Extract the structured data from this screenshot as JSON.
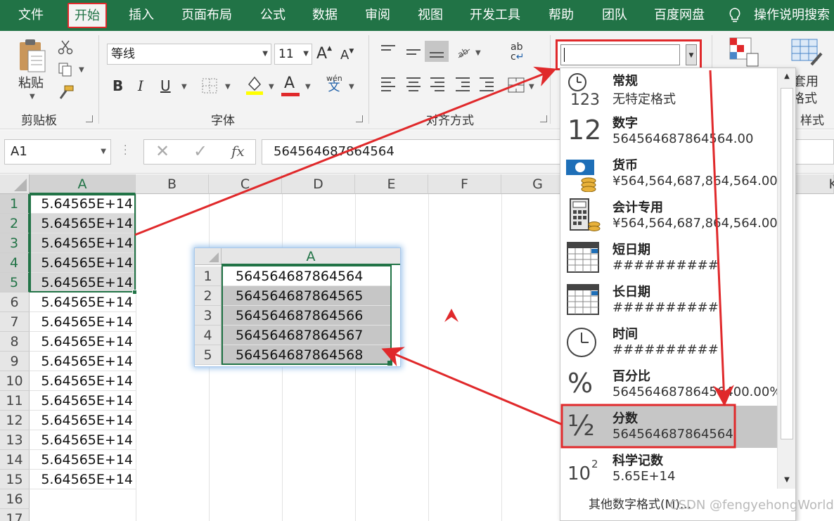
{
  "tabs": [
    "文件",
    "开始",
    "插入",
    "页面布局",
    "公式",
    "数据",
    "审阅",
    "视图",
    "开发工具",
    "帮助",
    "团队",
    "百度网盘"
  ],
  "tab_search": "操作说明搜索",
  "colors": {
    "accent": "#217346",
    "highlight": "#e0292b"
  },
  "ribbon": {
    "clipboard": {
      "paste_label": "粘贴",
      "group_label": "剪贴板"
    },
    "font": {
      "font_name": "等线",
      "font_size": "11",
      "bold": "B",
      "italic": "I",
      "underline": "U",
      "font_color_letter": "A",
      "wen": "wén",
      "wen2": "文",
      "grow": "A",
      "shrink": "A",
      "group_label": "字体"
    },
    "align": {
      "group_label": "对齐方式",
      "ab": "ab",
      "c": "c"
    },
    "styles": {
      "table_format_1": "套用",
      "table_format_2": "格式",
      "group_label": "样式"
    }
  },
  "formula_bar": {
    "name_box": "A1",
    "fx": "fx",
    "value": "564564687864564"
  },
  "grid": {
    "columns": [
      "A",
      "B",
      "C",
      "D",
      "E",
      "F",
      "G",
      "K"
    ],
    "rows": [
      "1",
      "2",
      "3",
      "4",
      "5",
      "6",
      "7",
      "8",
      "9",
      "10",
      "11",
      "12",
      "13",
      "14",
      "15",
      "16",
      "17"
    ],
    "col_a_values": [
      "5.64565E+14",
      "5.64565E+14",
      "5.64565E+14",
      "5.64565E+14",
      "5.64565E+14",
      "5.64565E+14",
      "5.64565E+14",
      "5.64565E+14",
      "5.64565E+14",
      "5.64565E+14",
      "5.64565E+14",
      "5.64565E+14",
      "5.64565E+14",
      "5.64565E+14",
      "5.64565E+14"
    ]
  },
  "inset": {
    "column": "A",
    "rows": [
      "1",
      "2",
      "3",
      "4",
      "5"
    ],
    "values": [
      "564564687864564",
      "564564687864565",
      "564564687864566",
      "564564687864567",
      "564564687864568"
    ]
  },
  "number_format": {
    "current": "",
    "items": [
      {
        "name": "常规",
        "preview": "无特定格式",
        "icon": "clock-123-icon"
      },
      {
        "name": "数字",
        "preview": "564564687864564.00",
        "icon": "number-12-icon",
        "icon_text": "12"
      },
      {
        "name": "货币",
        "preview": "¥564,564,687,864,564.00",
        "icon": "banknote-coins-icon"
      },
      {
        "name": "会计专用",
        "preview": " ¥564,564,687,864,564.00",
        "icon": "calculator-coins-icon"
      },
      {
        "name": "短日期",
        "preview": "##########",
        "icon": "calendar-icon"
      },
      {
        "name": "长日期",
        "preview": "##########",
        "icon": "calendar-icon"
      },
      {
        "name": "时间",
        "preview": "##########",
        "icon": "clock-icon"
      },
      {
        "name": "百分比",
        "preview": "56456468786456400.00%",
        "icon": "percent-icon",
        "icon_text": "%"
      },
      {
        "name": "分数",
        "preview": "564564687864564",
        "icon": "fraction-icon",
        "icon_text": "½"
      },
      {
        "name": "科学记数",
        "preview": "5.65E+14",
        "icon": "power-icon",
        "icon_text": "10",
        "icon_sup": "2"
      }
    ],
    "icon_123": "123",
    "more": "其他数字格式(M)..."
  },
  "watermark": "CSDN @fengyehongWorld"
}
